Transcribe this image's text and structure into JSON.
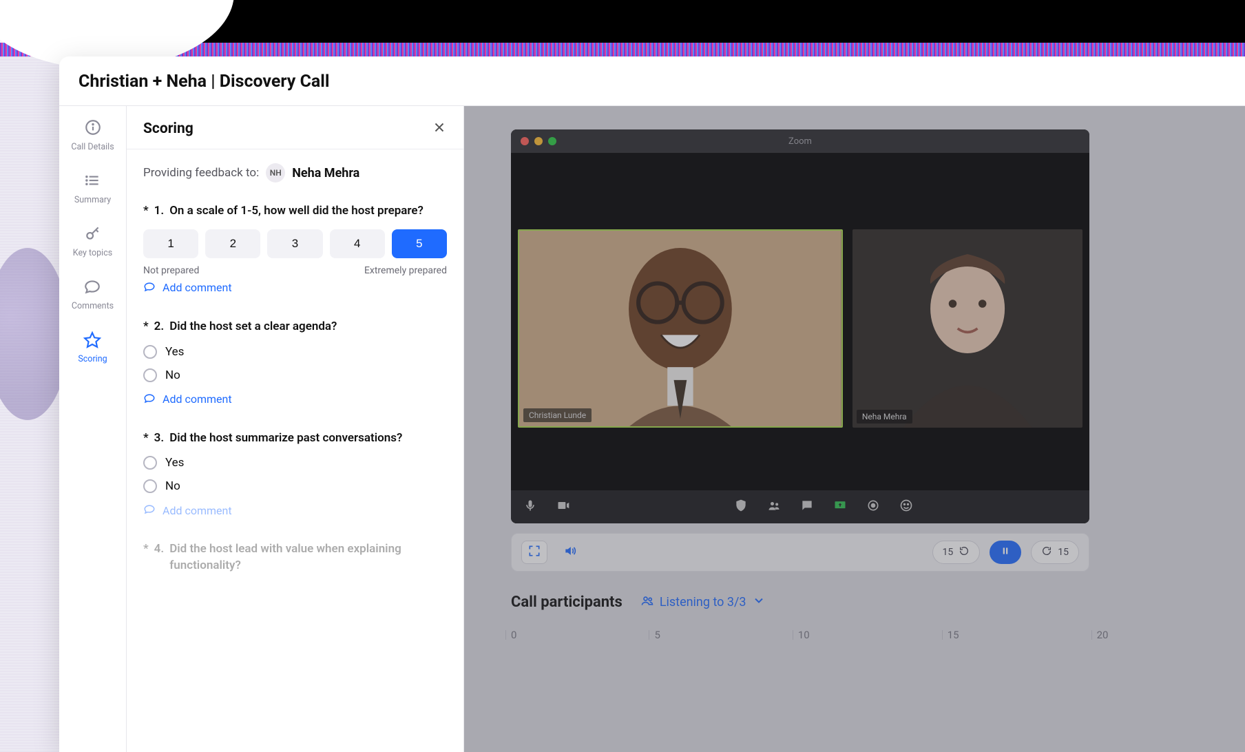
{
  "page_title": "Christian + Neha | Discovery Call",
  "rail": {
    "call_details": "Call Details",
    "summary": "Summary",
    "key_topics": "Key topics",
    "comments": "Comments",
    "scoring": "Scoring"
  },
  "scoring": {
    "title": "Scoring",
    "feedback_to_label": "Providing feedback to:",
    "recipient_initials": "NH",
    "recipient_name": "Neha Mehra",
    "add_comment_label": "Add comment",
    "scale_low": "Not prepared",
    "scale_high": "Extremely prepared",
    "scale_options": [
      "1",
      "2",
      "3",
      "4",
      "5"
    ],
    "selected_scale": "5",
    "q1": {
      "num": "1.",
      "text": "On a scale of 1-5, how well did the host prepare?"
    },
    "q2": {
      "num": "2.",
      "text": "Did the host set a clear agenda?",
      "opt_yes": "Yes",
      "opt_no": "No"
    },
    "q3": {
      "num": "3.",
      "text": "Did the host summarize past conversations?",
      "opt_yes": "Yes",
      "opt_no": "No"
    },
    "q4": {
      "num": "4.",
      "text": "Did the host lead with value when explaining functionality?"
    }
  },
  "zoom": {
    "app_title": "Zoom",
    "participant1": "Christian Lunde",
    "participant2": "Neha Mehra"
  },
  "player": {
    "skip_back": "15",
    "skip_fwd": "15"
  },
  "participants": {
    "title": "Call participants",
    "listening": "Listening to 3/3",
    "ticks": [
      "0",
      "5",
      "10",
      "15",
      "20"
    ]
  }
}
